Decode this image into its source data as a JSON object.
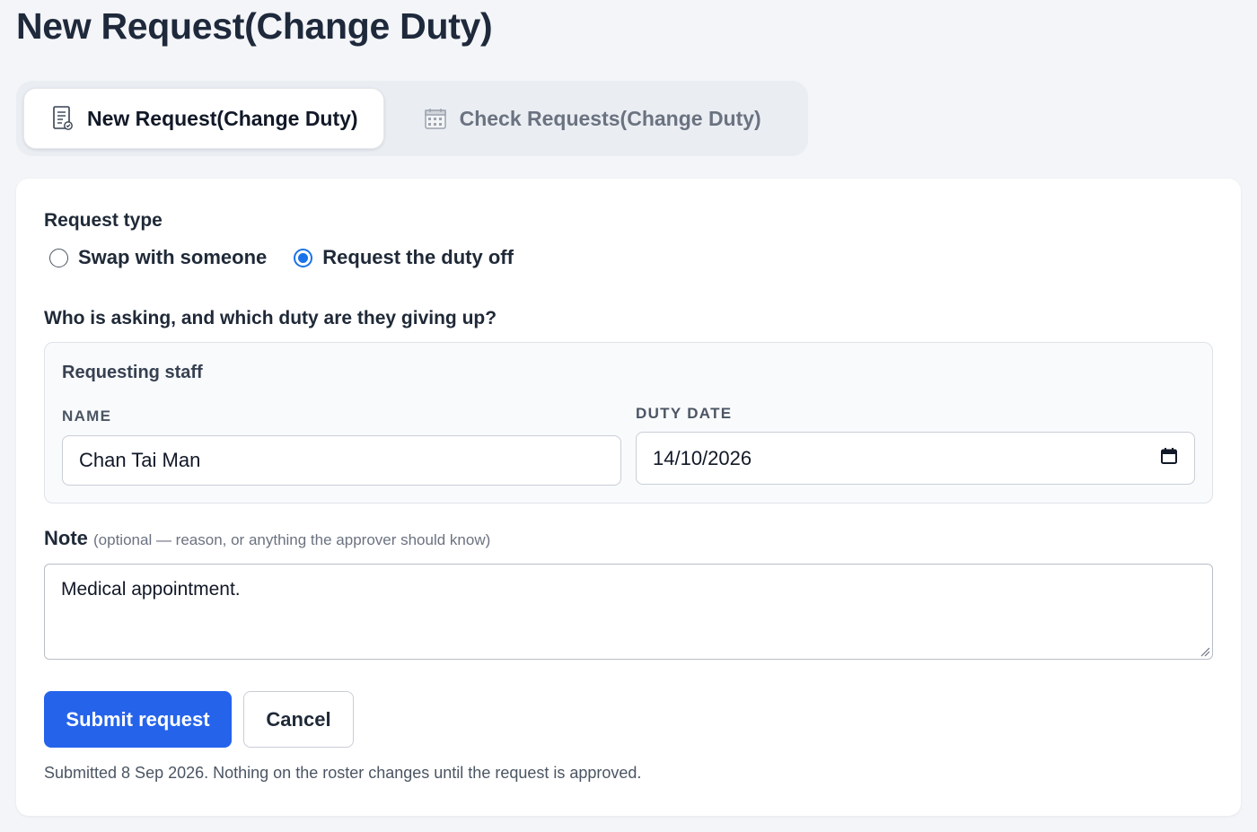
{
  "page_title": "New Request(Change Duty)",
  "tabs": [
    {
      "label": "New Request(Change Duty)",
      "icon": "document-pen-icon",
      "active": true
    },
    {
      "label": "Check Requests(Change Duty)",
      "icon": "calendar-icon",
      "active": false
    }
  ],
  "request_type": {
    "label": "Request type",
    "options": [
      {
        "label": "Swap with someone",
        "checked": false
      },
      {
        "label": "Request the duty off",
        "checked": true
      }
    ]
  },
  "staff_section": {
    "question": "Who is asking, and which duty are they giving up?",
    "heading": "Requesting staff",
    "name_label": "NAME",
    "name_value": "Chan Tai Man",
    "date_label": "DUTY DATE",
    "date_value": "14/10/2026"
  },
  "note": {
    "label": "Note",
    "hint": "(optional — reason, or anything the approver should know)",
    "value": "Medical appointment."
  },
  "actions": {
    "submit_label": "Submit request",
    "cancel_label": "Cancel"
  },
  "footnote": "Submitted 8 Sep 2026. Nothing on the roster changes until the request is approved.",
  "colors": {
    "primary": "#2563eb",
    "radio_accent": "#1a73e8",
    "background": "#f3f5f8"
  }
}
